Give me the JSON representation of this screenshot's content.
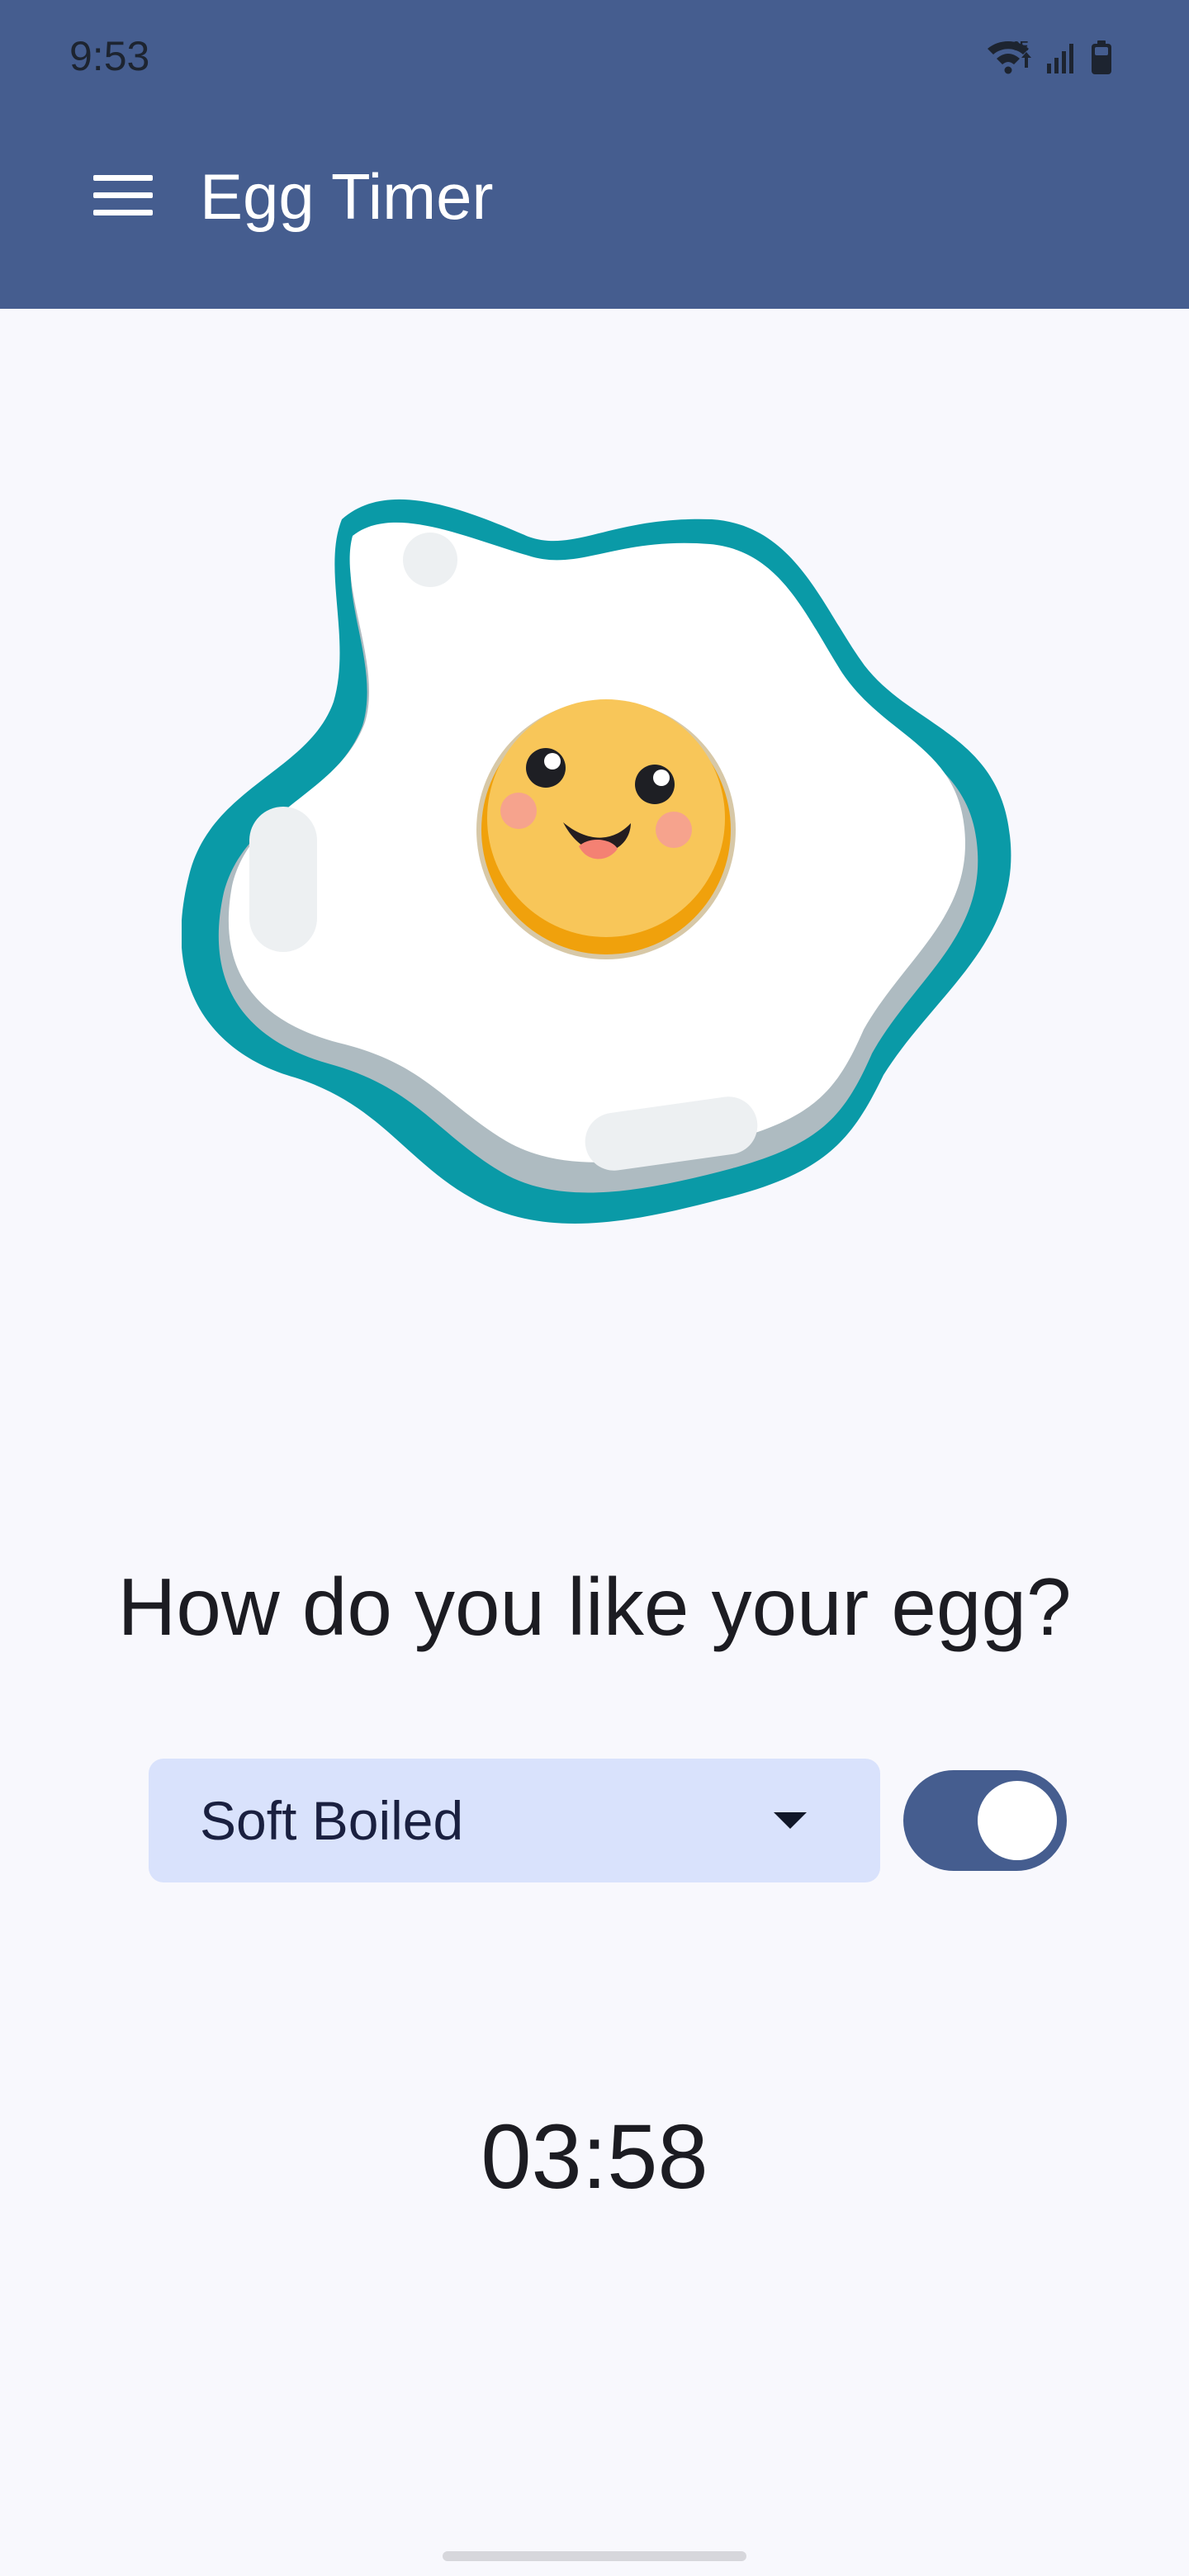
{
  "status_bar": {
    "time": "9:53",
    "icons": [
      "wifi-icon",
      "signal-icon",
      "battery-icon"
    ],
    "network_label": "6E"
  },
  "app_bar": {
    "title": "Egg Timer",
    "menu_icon": "hamburger-menu-icon",
    "background_color": "#455d8f"
  },
  "illustration": {
    "name": "smiling-fried-egg",
    "colors": {
      "outline": "#0a9aa7",
      "egg_white": "#ffffff",
      "yolk": "#f8c659",
      "yolk_shadow": "#f0a10c"
    }
  },
  "question": "How do you like your egg?",
  "egg_selector": {
    "selected_value": "Soft Boiled",
    "options_visible": [
      "Soft Boiled"
    ],
    "background_color": "#d9e2fc",
    "dropdown_icon": "dropdown-arrow-icon"
  },
  "timer_toggle": {
    "checked": true,
    "track_color": "#455d8f",
    "thumb_color": "#ffffff"
  },
  "timer": {
    "display": "03:58"
  }
}
